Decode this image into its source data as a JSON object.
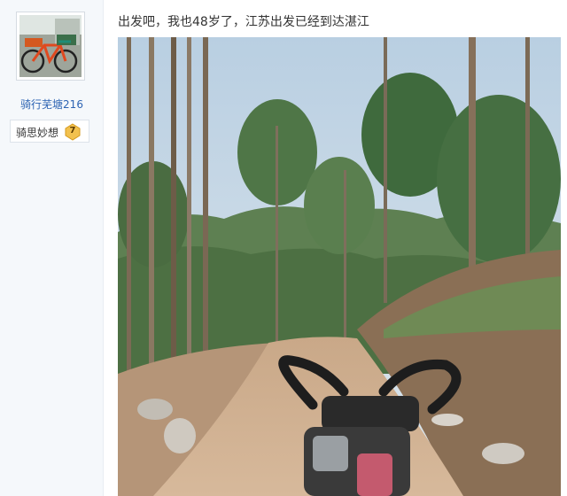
{
  "author": {
    "username": "骑行芜塘216",
    "level_label": "骑思妙想",
    "level_number": "7",
    "avatar": "bicycle-avatar"
  },
  "post": {
    "text": "出发吧，我也48岁了，江苏出发已经到达湛江",
    "image": "forest-dirt-road-bike-handlebar-photo"
  },
  "colors": {
    "username": "#2d64b3",
    "badge": "#f2c14e"
  }
}
